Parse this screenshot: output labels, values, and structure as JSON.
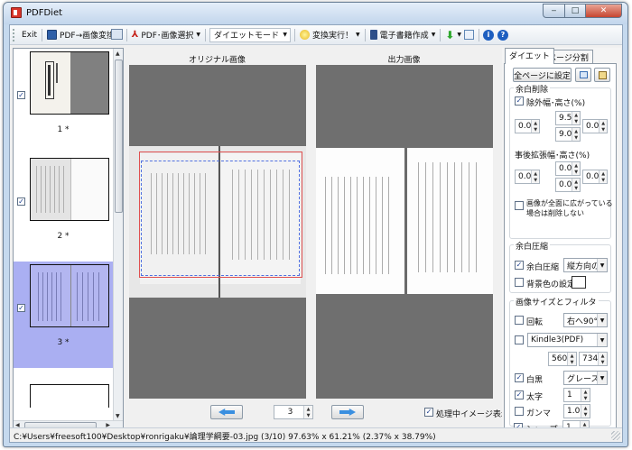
{
  "window": {
    "title": "PDFDiet",
    "minimize": "‒",
    "maximize": "□",
    "close": "✕"
  },
  "toolbar": {
    "exit": "Exit",
    "pdf_to_image": "PDF→画像変換",
    "pdf_image_select": "PDF･画像選択",
    "mode_value": "ダイエットモード",
    "execute": "変換実行！",
    "ebook": "電子書籍作成",
    "info": "i",
    "help": "?"
  },
  "thumbnails": [
    {
      "label": "1 *",
      "checked": true,
      "selected": false
    },
    {
      "label": "2 *",
      "checked": true,
      "selected": false
    },
    {
      "label": "3 *",
      "checked": true,
      "selected": true
    }
  ],
  "panes": {
    "original_label": "オリジナル画像",
    "output_label": "出力画像"
  },
  "nav": {
    "page": "3",
    "show_processing": "処理中イメージ表示",
    "show_processing_checked": true
  },
  "tabs": {
    "diet": "ダイエット",
    "split": "ページ分割"
  },
  "settings": {
    "all_pages_button": "全ページに設定",
    "margin_group": "余白削除",
    "exclude_label": "除外幅･高さ(%)",
    "exclude_checked": true,
    "exclude_top": "9.5",
    "exclude_bottom": "9.0",
    "exclude_left": "0.0",
    "exclude_right": "0.0",
    "expand_label": "事後拡張幅･高さ(%)",
    "expand_top": "0.0",
    "expand_bottom": "0.0",
    "expand_left": "0.0",
    "expand_right": "0.0",
    "nodelete_label_1": "画像が全面に広がっている",
    "nodelete_label_2": "場合は削除しない",
    "nodelete_checked": false,
    "compress_group": "余白圧縮",
    "compress_label": "余白圧縮",
    "compress_checked": true,
    "compress_dir": "縦方向のみ",
    "bgcolor_label": "背景色の設定",
    "bgcolor_checked": false,
    "size_group": "画像サイズとフィルタ",
    "rotate_label": "回転",
    "rotate_checked": false,
    "rotate_value": "右へ90°",
    "device_checked": false,
    "device_value": "Kindle3(PDF)",
    "width": "560",
    "height": "734",
    "bw_label": "白黒",
    "bw_checked": true,
    "bw_value": "グレースケール",
    "bold_label": "太字",
    "bold_checked": true,
    "bold_value": "1",
    "gamma_label": "ガンマ",
    "gamma_checked": false,
    "gamma_value": "1.0",
    "sharp_label": "シャープ",
    "sharp_checked": true,
    "sharp_value": "1"
  },
  "status": {
    "text": "C:¥Users¥freesoft100¥Desktop¥ronrigaku¥論理学綱要-03.jpg (3/10)  97.63% x 61.21% (2.37% x 38.79%)"
  },
  "colors": {
    "selection": "#aaaff2",
    "pane_bg": "#6f6f6f",
    "crop_red": "#e05050",
    "crop_blue": "#5070e0"
  }
}
